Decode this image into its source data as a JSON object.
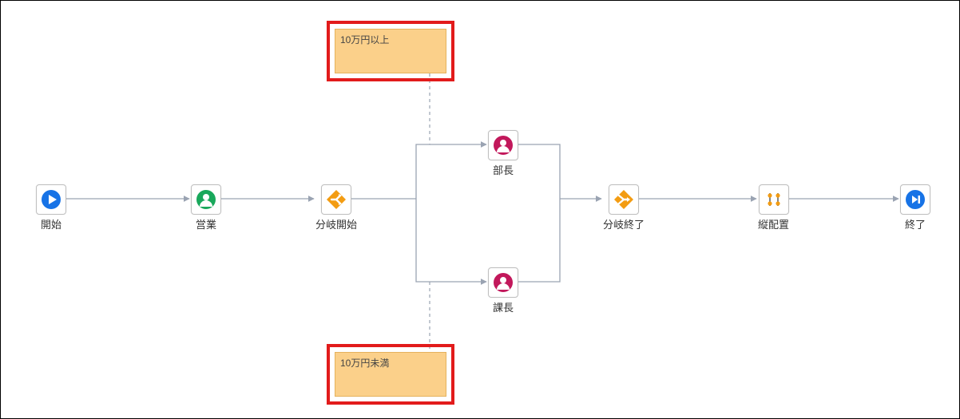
{
  "nodes": {
    "start": {
      "label": "開始"
    },
    "sales": {
      "label": "営業"
    },
    "branch_start": {
      "label": "分岐開始"
    },
    "dept_head": {
      "label": "部長"
    },
    "section_head": {
      "label": "課長"
    },
    "branch_end": {
      "label": "分岐終了"
    },
    "vertical": {
      "label": "縦配置"
    },
    "end": {
      "label": "終了"
    }
  },
  "conditions": {
    "top": {
      "label": "10万円以上"
    },
    "bottom": {
      "label": "10万円未満"
    }
  }
}
